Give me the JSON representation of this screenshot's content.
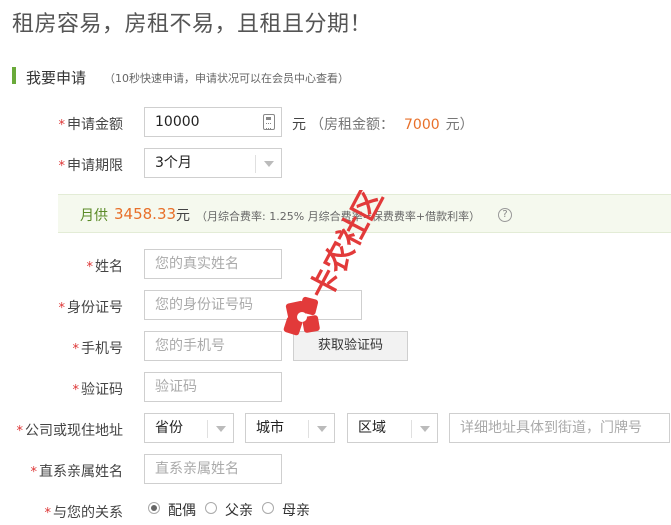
{
  "hero_title": "租房容易，房租不易，且租且分期！",
  "section": {
    "title": "我要申请",
    "note": "（10秒快速申请，申请状况可以在会员中心查看）"
  },
  "required_mark": "*",
  "amount": {
    "label": "申请金额",
    "value": "10000",
    "unit": "元",
    "rent_prefix": "（房租金额：",
    "rent_value": "7000",
    "rent_suffix": "元）"
  },
  "term": {
    "label": "申请期限",
    "value": "3个月"
  },
  "monthly": {
    "label": "月供",
    "value": "3458.33",
    "unit": "元",
    "note": "（月综合费率: 1.25%  月综合费率=保费费率+借款利率）",
    "help_glyph": "?"
  },
  "name": {
    "label": "姓名",
    "placeholder": "您的真实姓名"
  },
  "id_number": {
    "label": "身份证号",
    "placeholder": "您的身份证号码"
  },
  "phone": {
    "label": "手机号",
    "placeholder": "您的手机号",
    "button": "获取验证码"
  },
  "code": {
    "label": "验证码",
    "placeholder": "验证码"
  },
  "address": {
    "label": "公司或现住地址",
    "province": "省份",
    "city": "城市",
    "district": "区域",
    "detail_placeholder": "详细地址具体到街道，门牌号"
  },
  "relative_name": {
    "label": "直系亲属姓名",
    "placeholder": "直系亲属姓名"
  },
  "relation": {
    "label": "与您的关系",
    "options": [
      "配偶",
      "父亲",
      "母亲"
    ],
    "selected": "配偶"
  },
  "watermark_text": "卡农社区",
  "colors": {
    "accent_green": "#6aaa3a",
    "highlight_orange": "#e8702a",
    "required_red": "#d33333"
  }
}
